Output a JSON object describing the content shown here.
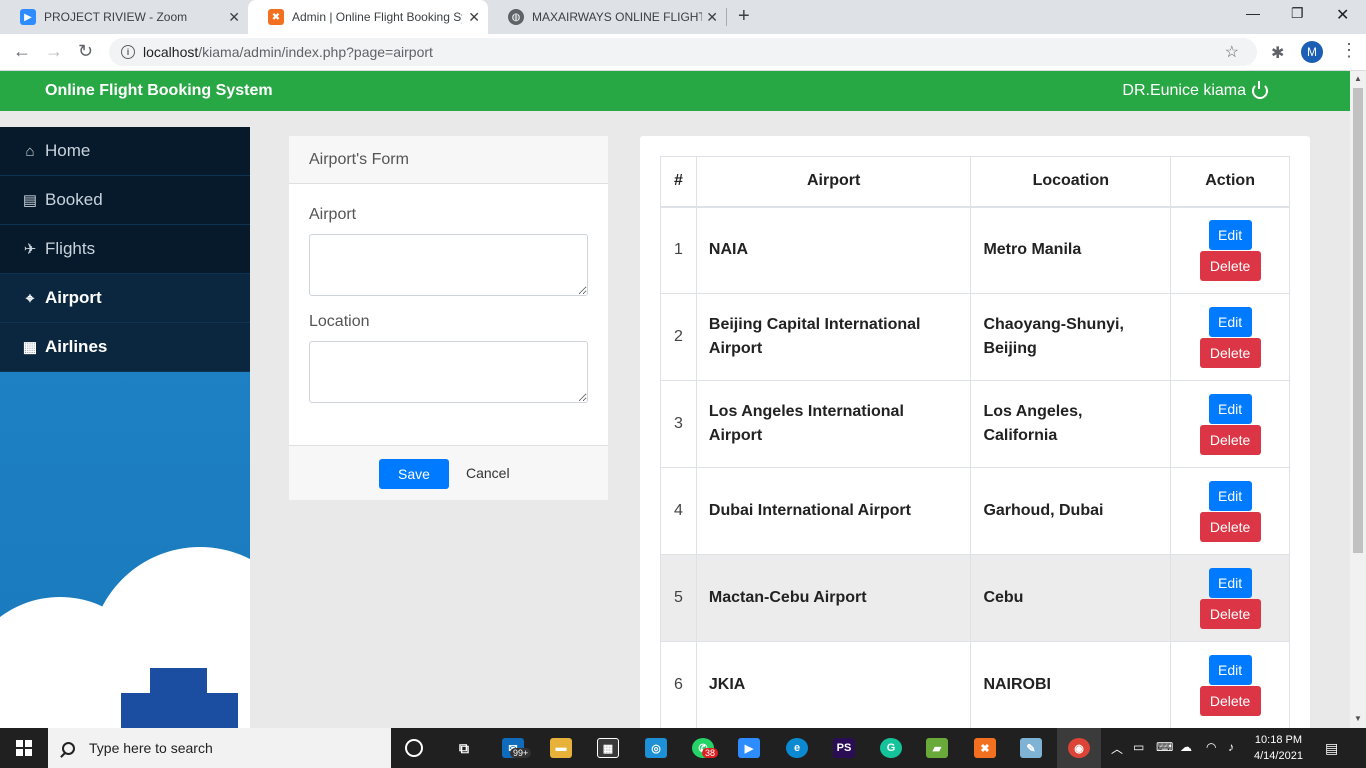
{
  "browser": {
    "tabs": [
      {
        "title": "PROJECT RIVIEW - Zoom",
        "active": false
      },
      {
        "title": "Admin | Online Flight Booking Sy",
        "active": true
      },
      {
        "title": "MAXAIRWAYS ONLINE FLIGHT BO",
        "active": false
      }
    ],
    "url_host": "localhost",
    "url_path": "/kiama/admin/index.php?page=airport",
    "profile_initial": "M"
  },
  "app": {
    "brand": "Online Flight Booking System",
    "user": "DR.Eunice kiama"
  },
  "sidebar": {
    "items": [
      {
        "label": "Home",
        "icon": "home-icon"
      },
      {
        "label": "Booked",
        "icon": "book-icon"
      },
      {
        "label": "Flights",
        "icon": "plane-icon"
      },
      {
        "label": "Airport",
        "icon": "map-marked-icon",
        "active": true
      },
      {
        "label": "Airlines",
        "icon": "building-icon"
      }
    ]
  },
  "form": {
    "title": "Airport's Form",
    "airport_label": "Airport",
    "location_label": "Location",
    "airport_value": "",
    "location_value": "",
    "save_label": "Save",
    "cancel_label": "Cancel"
  },
  "table": {
    "headers": [
      "#",
      "Airport",
      "Locoation",
      "Action"
    ],
    "edit_label": "Edit",
    "delete_label": "Delete",
    "rows": [
      {
        "num": "1",
        "airport": "NAIA",
        "location": "Metro Manila"
      },
      {
        "num": "2",
        "airport": "Beijing Capital International Airport",
        "location": "Chaoyang-Shunyi, Beijing"
      },
      {
        "num": "3",
        "airport": "Los Angeles International Airport",
        "location": "Los Angeles, California"
      },
      {
        "num": "4",
        "airport": "Dubai International Airport",
        "location": "Garhoud, Dubai"
      },
      {
        "num": "5",
        "airport": "Mactan-Cebu Airport",
        "location": "Cebu"
      },
      {
        "num": "6",
        "airport": "JKIA",
        "location": "NAIROBI"
      }
    ]
  },
  "taskbar": {
    "search_placeholder": "Type here to search",
    "mail_badge": "99+",
    "whatsapp_badge": "38",
    "time": "10:18 PM",
    "date": "4/14/2021"
  },
  "colors": {
    "topbar": "#28a745",
    "primary": "#007bff",
    "danger": "#dc3545",
    "sidebar_dark": "#061a2b"
  }
}
